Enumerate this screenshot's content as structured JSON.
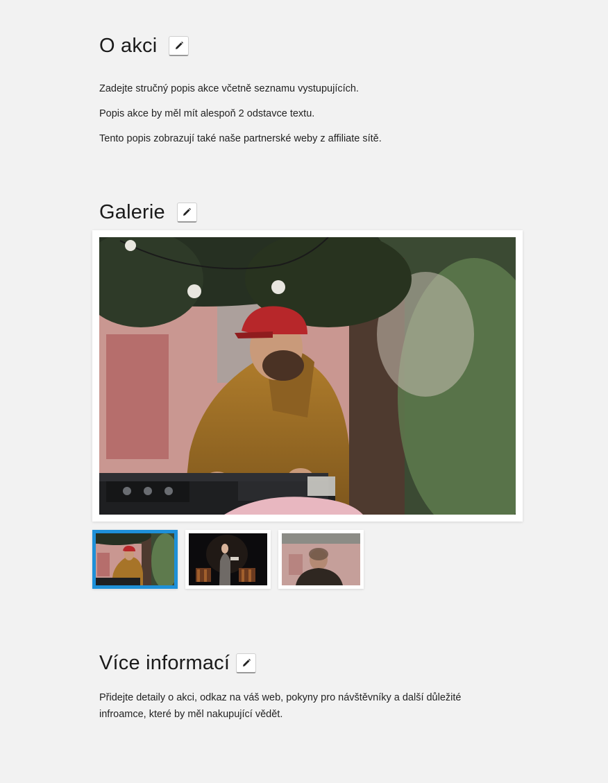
{
  "about": {
    "title": "O akci",
    "paragraphs": [
      "Zadejte stručný popis akce včetně seznamu vystupujících.",
      "Popis akce by měl mít alespoň 2 odstavce textu.",
      "Tento popis zobrazují také naše partnerské weby z affiliate sítě."
    ]
  },
  "gallery": {
    "title": "Galerie",
    "selected_index": 0,
    "thumbnails": [
      {
        "subject": "dj-at-turntables"
      },
      {
        "subject": "performer-on-stage"
      },
      {
        "subject": "man-from-behind"
      }
    ]
  },
  "more_info": {
    "title": "Více informací",
    "text": "Přidejte detaily o akci, odkaz na váš web, pokyny pro návštěvníky a další důležité infroamce, které by měl nakupující vědět."
  },
  "icons": {
    "edit": "pencil-icon"
  },
  "colors": {
    "background": "#f2f2f2",
    "thumb_active_border": "#1e90d8"
  }
}
